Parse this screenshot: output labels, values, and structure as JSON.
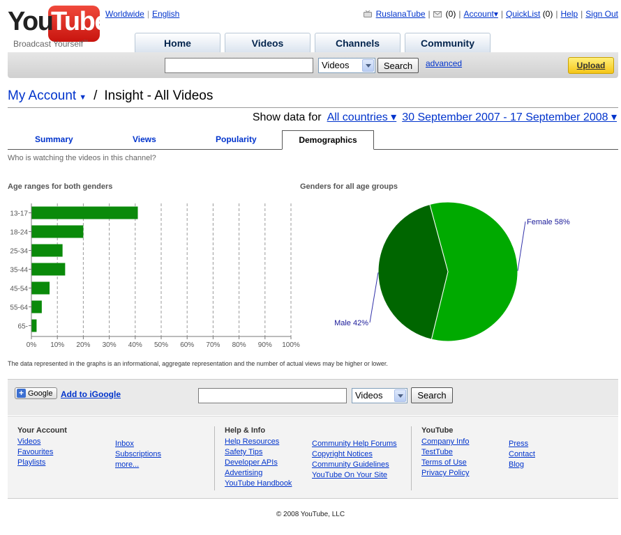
{
  "brand": {
    "you": "You",
    "tube": "Tube",
    "tagline": "Broadcast Yourself",
    "tm": "™",
    "accent": "#e21a1a"
  },
  "locale": {
    "worldwide": "Worldwide",
    "english": "English"
  },
  "userbar": {
    "username": "RuslanaTube",
    "inbox_count": "(0)",
    "account": "Account",
    "quicklist": "QuickList",
    "quicklist_count": "(0)",
    "help": "Help",
    "signout": "Sign Out"
  },
  "nav": {
    "tabs": [
      "Home",
      "Videos",
      "Channels",
      "Community"
    ]
  },
  "search": {
    "value": "",
    "category": "Videos",
    "button": "Search",
    "advanced": "advanced",
    "upload": "Upload"
  },
  "page": {
    "my_account": "My Account",
    "section": "Insight - All Videos",
    "show_data_for": "Show data for",
    "countries": "All countries ▾",
    "date_range": "30 September 2007 - 17 September 2008 ▾"
  },
  "tabs": {
    "summary": "Summary",
    "views": "Views",
    "popularity": "Popularity",
    "demographics": "Demographics"
  },
  "question": "Who is watching the videos in this channel?",
  "footnote": "The data represented in the graphs is an informational, aggregate representation and the number of actual views may be higher or lower.",
  "chart_data": [
    {
      "type": "bar",
      "orientation": "horizontal",
      "title": "Age ranges for both genders",
      "categories": [
        "13-17",
        "18-24",
        "25-34",
        "35-44",
        "45-54",
        "55-64",
        "65-"
      ],
      "values": [
        41,
        20,
        12,
        13,
        7,
        4,
        2
      ],
      "xlim": [
        0,
        100
      ],
      "xticks": [
        "0%",
        "10%",
        "20%",
        "30%",
        "40%",
        "50%",
        "60%",
        "70%",
        "80%",
        "90%",
        "100%"
      ],
      "grid": "vertical dashed",
      "color": "#0a8a0a"
    },
    {
      "type": "pie",
      "title": "Genders for all age groups",
      "labels": [
        "Female 58%",
        "Male 42%"
      ],
      "values": [
        58,
        42
      ],
      "colors": [
        "#00aa00",
        "#006600"
      ]
    }
  ],
  "gbar": {
    "google_badge": "Google",
    "add_igoogle": "Add to iGoogle",
    "search_value": "",
    "category": "Videos",
    "button": "Search"
  },
  "footer": {
    "your_account": {
      "title": "Your Account",
      "col1": [
        "Videos",
        "Favourites",
        "Playlists"
      ],
      "col2": [
        "Inbox",
        "Subscriptions",
        "more..."
      ]
    },
    "help_info": {
      "title": "Help & Info",
      "col1": [
        "Help Resources",
        "Safety Tips",
        "Developer APIs",
        "Advertising",
        "YouTube Handbook"
      ],
      "col2": [
        "Community Help Forums",
        "Copyright Notices",
        "Community Guidelines",
        "YouTube On Your Site"
      ]
    },
    "youtube": {
      "title": "YouTube",
      "col1": [
        "Company Info",
        "TestTube",
        "Terms of Use",
        "Privacy Policy"
      ],
      "col2": [
        "Press",
        "Contact",
        "Blog"
      ]
    }
  },
  "copyright": "© 2008 YouTube, LLC"
}
